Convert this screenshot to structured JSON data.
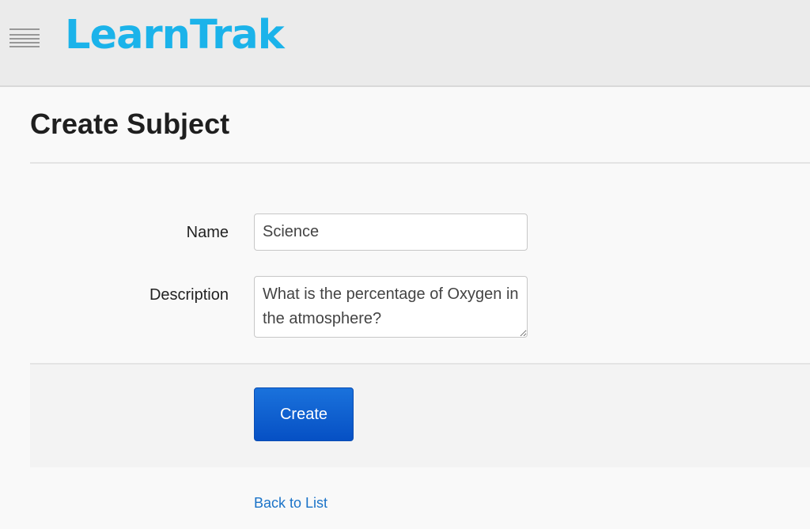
{
  "header": {
    "brand": "LearnTrak",
    "menu_icon": "hamburger-menu-icon",
    "brand_color": "#1bb3ea"
  },
  "page": {
    "title": "Create Subject"
  },
  "form": {
    "name_label": "Name",
    "name_value": "Science",
    "description_label": "Description",
    "description_value": "What is the percentage of Oxygen in the atmosphere?",
    "create_label": "Create",
    "button_color": "#0a5fd1"
  },
  "footer": {
    "back_link": "Back to List",
    "link_color": "#1a73c8"
  }
}
